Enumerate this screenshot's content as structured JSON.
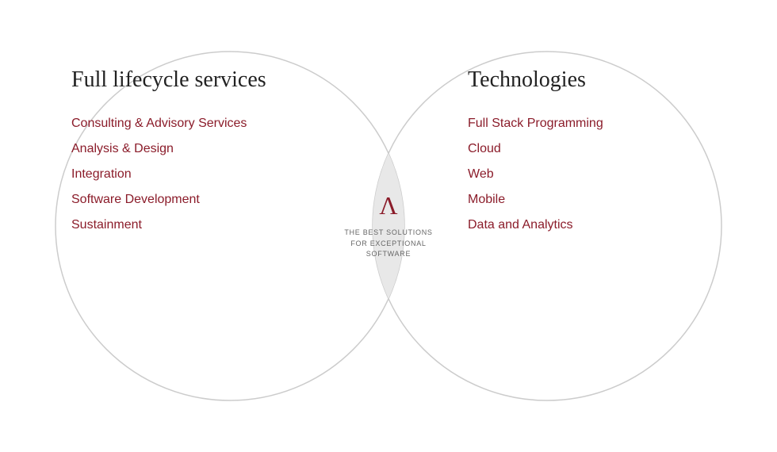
{
  "left": {
    "title": "Full lifecycle services",
    "items": [
      "Consulting & Advisory Services",
      "Analysis & Design",
      "Integration",
      "Software Development",
      "Sustainment"
    ]
  },
  "right": {
    "title": "Technologies",
    "items": [
      "Full Stack Programming",
      "Cloud",
      "Web",
      "Mobile",
      "Data and Analytics"
    ]
  },
  "center": {
    "logo_symbol": "∧",
    "tagline_line1": "THE BEST SOLUTIONS",
    "tagline_line2": "FOR EXCEPTIONAL",
    "tagline_line3": "SOFTWARE"
  }
}
